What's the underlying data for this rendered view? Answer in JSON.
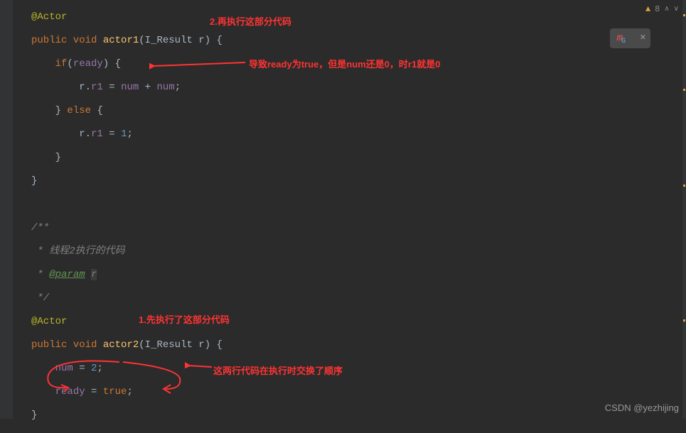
{
  "topRight": {
    "warnCount": "8"
  },
  "popup": {
    "icon": "m",
    "sub": "G"
  },
  "code": {
    "l1": "@Actor",
    "l2_kw1": "public",
    "l2_kw2": "void",
    "l2_method": "actor1",
    "l2_type": "I_Result",
    "l2_param": "r",
    "l3_kw": "if",
    "l3_var": "ready",
    "l4_r": "r",
    "l4_field": "r1",
    "l4_num": "num",
    "l5_kw": "else",
    "l6_r": "r",
    "l6_field": "r1",
    "l6_val": "1",
    "l10_c": "/**",
    "l11_c": " * 线程2执行的代码",
    "l12_c1": " * ",
    "l12_tag": "@param",
    "l12_p": "r",
    "l13_c": " */",
    "l14": "@Actor",
    "l15_kw1": "public",
    "l15_kw2": "void",
    "l15_method": "actor2",
    "l15_type": "I_Result",
    "l15_param": "r",
    "l16_var": "num",
    "l16_val": "2",
    "l17_var": "ready",
    "l17_val": "true"
  },
  "annotations": {
    "a1": "2.再执行这部分代码",
    "a2": "导致ready为true，但是num还是0，时r1就是0",
    "a3": "1.先执行了这部分代码",
    "a4": "这两行代码在执行时交换了顺序"
  },
  "watermark": "CSDN @yezhijing",
  "colors": {
    "anno": "#ff3333"
  }
}
